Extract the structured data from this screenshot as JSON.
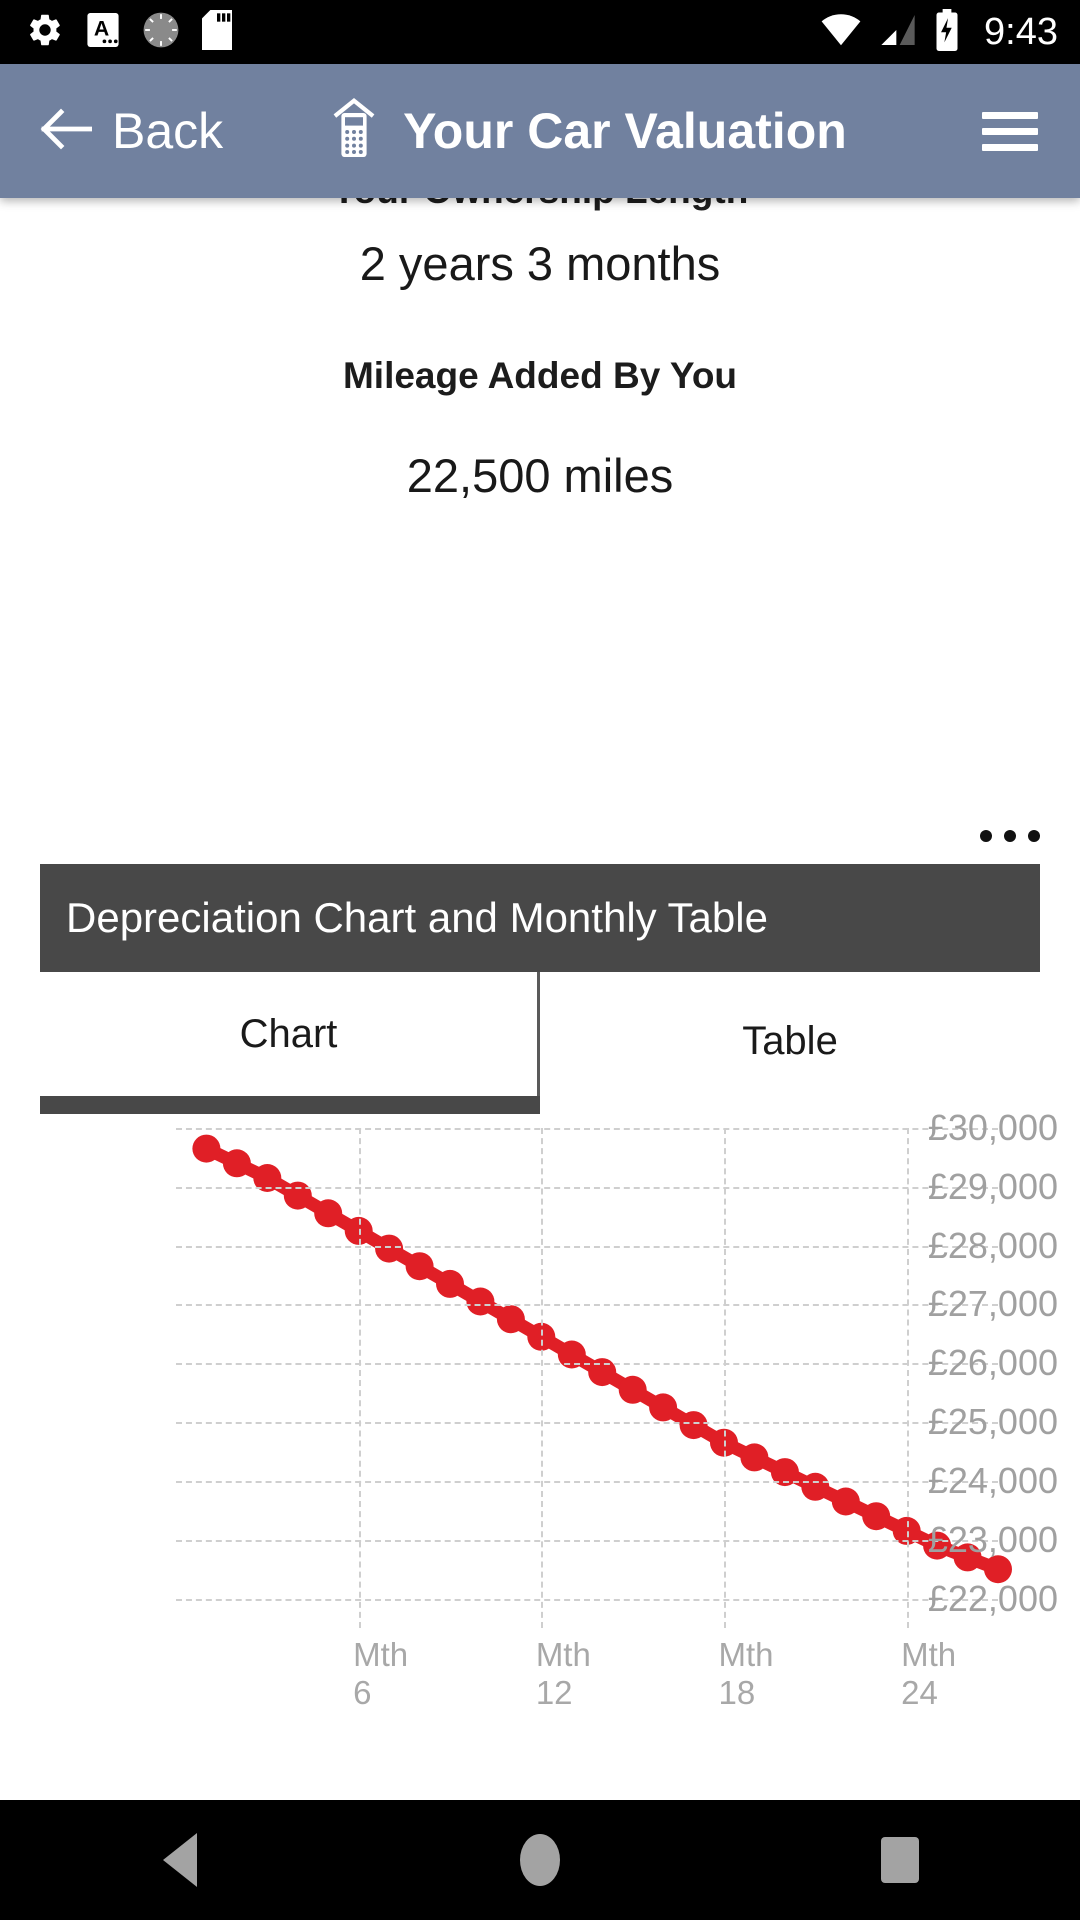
{
  "status_bar": {
    "time": "9:43",
    "left_icons": [
      "settings-gear-icon",
      "keyboard-a-icon",
      "loading-circle-icon",
      "sd-card-icon"
    ],
    "right_icons": [
      "wifi-icon",
      "cellular-signal-icon",
      "battery-charging-icon"
    ]
  },
  "header": {
    "back_label": "Back",
    "title": "Your Car Valuation",
    "title_icon": "valuation-calculator-icon",
    "menu_icon": "hamburger-menu-icon",
    "background_color": "#71819f"
  },
  "content": {
    "ownership_length_label": "Your Ownership Length",
    "ownership_length_value": "2 years 3 months",
    "mileage_label": "Mileage Added By You",
    "mileage_value": "22,500 miles"
  },
  "card": {
    "title": "Depreciation Chart and Monthly Table",
    "overflow_icon": "overflow-menu-icon",
    "header_color": "#484848",
    "tabs": [
      {
        "label": "Chart",
        "active": true
      },
      {
        "label": "Table",
        "active": false
      }
    ]
  },
  "chart_data": {
    "type": "line",
    "title": "Depreciation Chart and Monthly Table",
    "xlabel": "",
    "ylabel": "",
    "series_color": "#e01f26",
    "grid": true,
    "legend": "none",
    "ylim": [
      21500,
      30000
    ],
    "ytick_labels": [
      "£30,000",
      "£29,000",
      "£28,000",
      "£27,000",
      "£26,000",
      "£25,000",
      "£24,000",
      "£23,000",
      "£22,000"
    ],
    "ytick_values": [
      30000,
      29000,
      28000,
      27000,
      26000,
      25000,
      24000,
      23000,
      22000
    ],
    "xtick_labels": [
      "Mth\n6",
      "Mth\n12",
      "Mth\n18",
      "Mth\n24"
    ],
    "xtick_values": [
      6,
      12,
      18,
      24
    ],
    "xlim": [
      0,
      27
    ],
    "x": [
      1,
      2,
      3,
      4,
      5,
      6,
      7,
      8,
      9,
      10,
      11,
      12,
      13,
      14,
      15,
      16,
      17,
      18,
      19,
      20,
      21,
      22,
      23,
      24,
      25,
      26,
      27
    ],
    "values": [
      29650,
      29400,
      29150,
      28850,
      28550,
      28250,
      27950,
      27650,
      27350,
      27050,
      26750,
      26450,
      26150,
      25850,
      25550,
      25250,
      24950,
      24650,
      24400,
      24150,
      23900,
      23650,
      23400,
      23150,
      22900,
      22700,
      22500
    ]
  },
  "nav_bar": {
    "back_icon": "nav-back-icon",
    "home_icon": "nav-home-icon",
    "recents_icon": "nav-recents-icon"
  }
}
